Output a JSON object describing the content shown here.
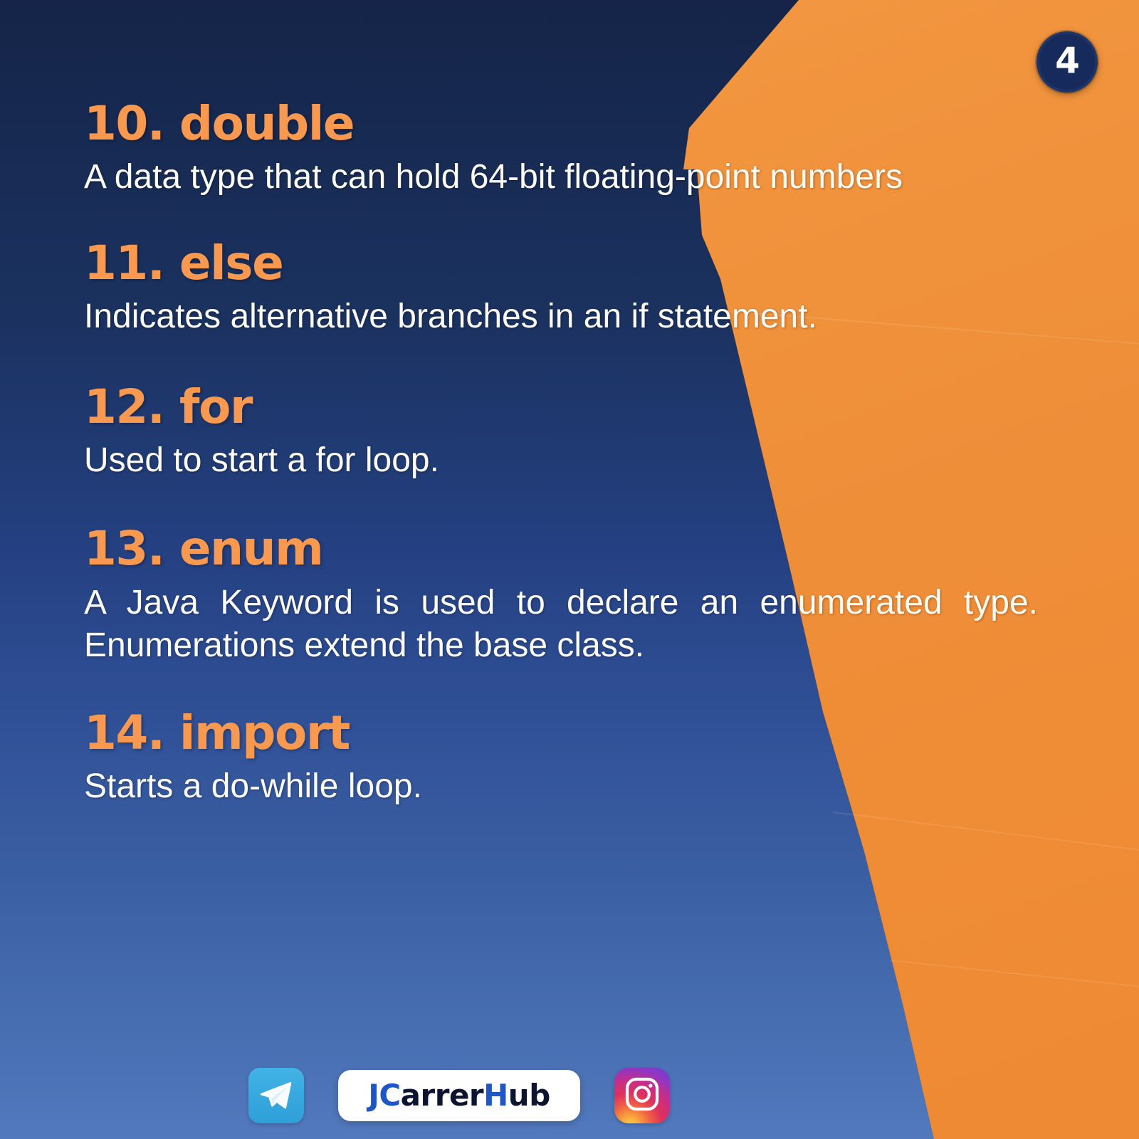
{
  "page": {
    "badge_number": "4",
    "theme": {
      "navy_dark": "#152448",
      "navy_light": "#5279bd",
      "orange": "#ef8f3a",
      "heading_orange": "#f9984f",
      "body_white": "#fdfcf7"
    }
  },
  "entries": [
    {
      "title": "10. double",
      "description": "A data type that can hold 64-bit floating-point numbers"
    },
    {
      "title": "11. else",
      "description": "Indicates alternative branches in an if statement."
    },
    {
      "title": "12. for",
      "description": "Used to start a for loop."
    },
    {
      "title": "13. enum",
      "description": "A Java Keyword is used to declare an enumerated type. Enumerations extend the base class."
    },
    {
      "title": "14. import",
      "description": "Starts a do-while loop."
    }
  ],
  "footer": {
    "telegram_icon": "telegram-paper-plane-icon",
    "instagram_icon": "instagram-camera-icon",
    "brand": {
      "full": "JCarrerHub",
      "part_blue_1": "JC",
      "part_dark_1": "arrer",
      "part_blue_2": "H",
      "part_dark_2": "ub"
    }
  }
}
